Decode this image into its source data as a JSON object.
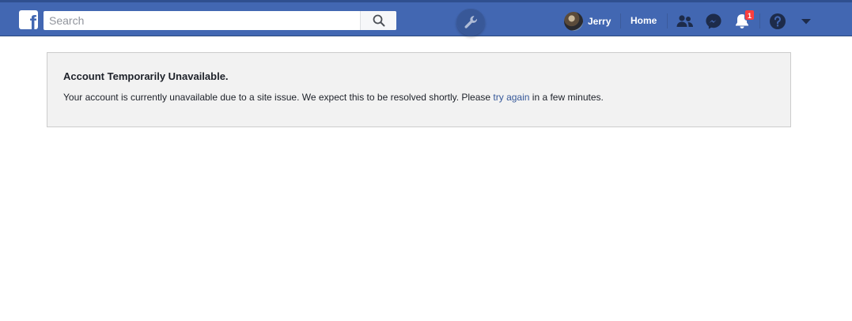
{
  "header": {
    "logo_letter": "f",
    "search": {
      "placeholder": "Search",
      "value": ""
    },
    "profile": {
      "name": "Jerry"
    },
    "home_label": "Home",
    "notifications_count": "1",
    "icons": {
      "logo": "facebook-logo-icon",
      "search": "search-icon",
      "tools": "wrench-icon",
      "friends": "friend-requests-icon",
      "messages": "messenger-icon",
      "notifications": "bell-icon",
      "help": "help-icon",
      "menu": "caret-down-icon"
    },
    "colors": {
      "bar": "#4267b2",
      "badge": "#fa3e3e"
    }
  },
  "notice": {
    "title": "Account Temporarily Unavailable.",
    "message_before_link": "Your account is currently unavailable due to a site issue. We expect this to be resolved shortly. Please ",
    "link_text": "try again",
    "message_after_link": " in a few minutes.",
    "colors": {
      "background": "#f2f2f2",
      "border": "#cccccc",
      "link": "#365899"
    }
  }
}
